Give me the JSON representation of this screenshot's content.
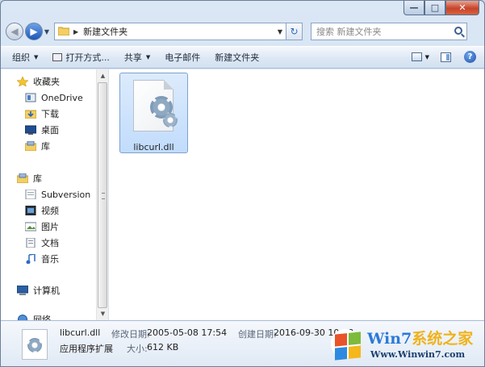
{
  "window": {
    "controls": {
      "minimize": "—",
      "maximize": "□",
      "close": "✕"
    }
  },
  "address": {
    "path": "新建文件夹",
    "search_placeholder": "搜索 新建文件夹"
  },
  "toolbar": {
    "organize": "组织",
    "open_with": "打开方式...",
    "share": "共享",
    "email": "电子邮件",
    "new_folder": "新建文件夹"
  },
  "sidebar": {
    "items": [
      {
        "label": "收藏夹",
        "icon": "star-icon",
        "header": true
      },
      {
        "label": "OneDrive",
        "icon": "onedrive-icon"
      },
      {
        "label": "下载",
        "icon": "download-folder-icon"
      },
      {
        "label": "桌面",
        "icon": "desktop-icon"
      },
      {
        "label": "库",
        "icon": "library-icon"
      },
      {
        "label": "库",
        "icon": "library-icon",
        "header": true
      },
      {
        "label": "Subversion",
        "icon": "subversion-icon"
      },
      {
        "label": "视频",
        "icon": "video-icon"
      },
      {
        "label": "图片",
        "icon": "picture-icon"
      },
      {
        "label": "文档",
        "icon": "document-icon"
      },
      {
        "label": "音乐",
        "icon": "music-icon"
      },
      {
        "label": "计算机",
        "icon": "computer-icon",
        "header": true
      },
      {
        "label": "网络",
        "icon": "network-icon",
        "header": true
      }
    ]
  },
  "files": [
    {
      "name": "libcurl.dll",
      "icon": "dll-gear-icon",
      "selected": true
    }
  ],
  "details": {
    "filename": "libcurl.dll",
    "type": "应用程序扩展",
    "modified_label": "修改日期:",
    "modified_value": "2005-05-08 17:54",
    "size_label": "大小:",
    "size_value": "612 KB",
    "created_label": "创建日期:",
    "created_value": "2016-09-30 10:48"
  },
  "watermark": {
    "title_a": "Win7",
    "title_b": "系统之家",
    "url": "Www.Winwin7.com"
  },
  "colors": {
    "accent": "#1d57b8",
    "selection": "#c1dcfc",
    "close_button": "#c7432a"
  }
}
